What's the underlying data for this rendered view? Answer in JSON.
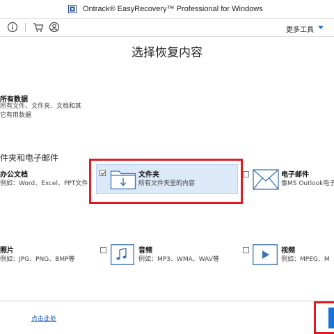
{
  "window": {
    "title": "Ontrack® EasyRecovery™ Professional for Windows"
  },
  "toolbar": {
    "info_icon": "info-icon",
    "cart_icon": "cart-icon",
    "account_icon": "account-icon",
    "more_tools_label": "更多工具"
  },
  "main": {
    "title": "选择恢复内容",
    "all_data": {
      "title": "所有数据",
      "desc_line1": "所有文件、文件夹、文档和其",
      "desc_line2": "它有用数据"
    },
    "section_title": "件夹和电子邮件",
    "items": [
      {
        "title": "办公文档",
        "desc": "例如：Word、Excel、PPT文件",
        "checked": false
      },
      {
        "title": "文件夹",
        "desc": "所有文件夹里的内容",
        "checked": true
      },
      {
        "title": "电子邮件",
        "desc": "像MS Outlook电子",
        "checked": false
      },
      {
        "title": "照片",
        "desc": "例如：JPG、PNG、BMP等",
        "checked": false
      },
      {
        "title": "音频",
        "desc": "例如：MP3、WMA、WAV等",
        "checked": false
      },
      {
        "title": "视频",
        "desc": "例如：MPEG、M",
        "checked": false
      }
    ]
  },
  "footer": {
    "link_label": "点击此处"
  },
  "colors": {
    "accent": "#1a73d9",
    "highlight": "#e01b24",
    "selected_bg": "#dbe9f8",
    "icon_blue": "#3c72b6"
  }
}
